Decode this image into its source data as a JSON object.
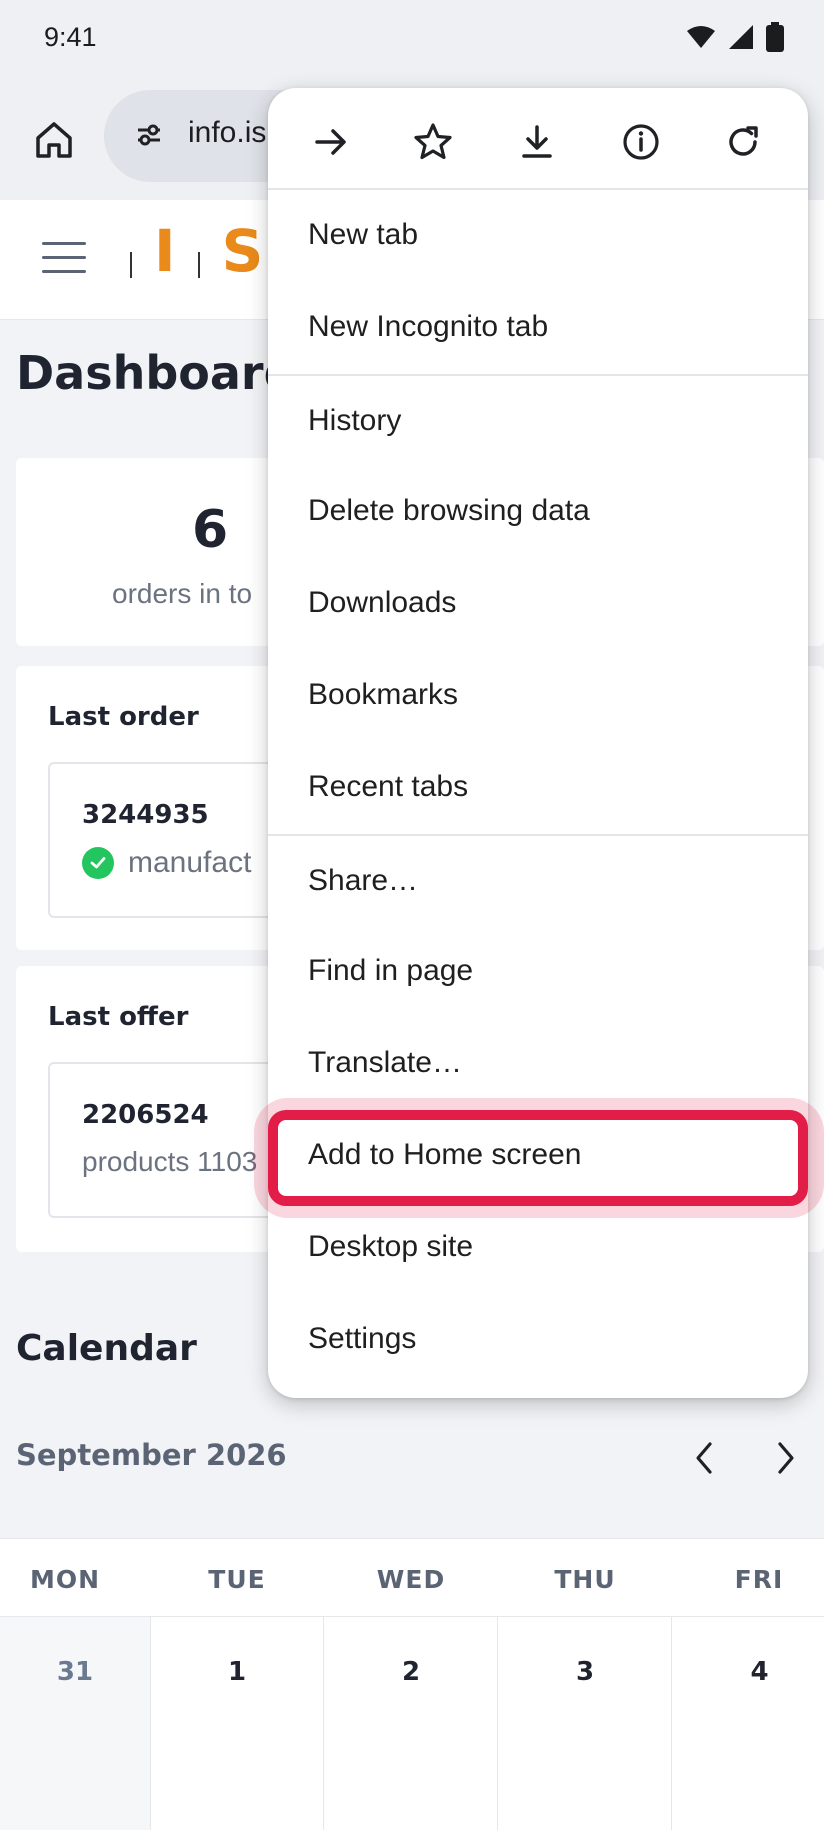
{
  "status_bar": {
    "time": "9:41"
  },
  "browser": {
    "url": "info.is"
  },
  "logo": {
    "letters": [
      "I",
      "S"
    ]
  },
  "dashboard": {
    "title": "Dashboard",
    "stats": {
      "value": "6",
      "label": "orders in to"
    },
    "last_order": {
      "label": "Last order",
      "id": "3244935",
      "status": "manufact"
    },
    "last_offer": {
      "label": "Last offer",
      "id": "2206524",
      "detail": "products 1103"
    }
  },
  "calendar": {
    "title": "Calendar",
    "month": "September 2026",
    "day_names": [
      "MON",
      "TUE",
      "WED",
      "THU",
      "FRI"
    ],
    "dates": [
      "31",
      "1",
      "2",
      "3",
      "4"
    ]
  },
  "menu": {
    "top_icons": [
      "forward-icon",
      "bookmark-star-icon",
      "download-icon",
      "info-icon",
      "refresh-icon"
    ],
    "items": [
      "New tab",
      "New Incognito tab",
      "History",
      "Delete browsing data",
      "Downloads",
      "Bookmarks",
      "Recent tabs",
      "Share…",
      "Find in page",
      "Translate…",
      "Add to Home screen",
      "Desktop site",
      "Settings"
    ],
    "highlighted_item": "Add to Home screen"
  },
  "colors": {
    "highlight": "#e11d48",
    "logo_orange": "#e98a1a",
    "check_green": "#22c55e"
  }
}
